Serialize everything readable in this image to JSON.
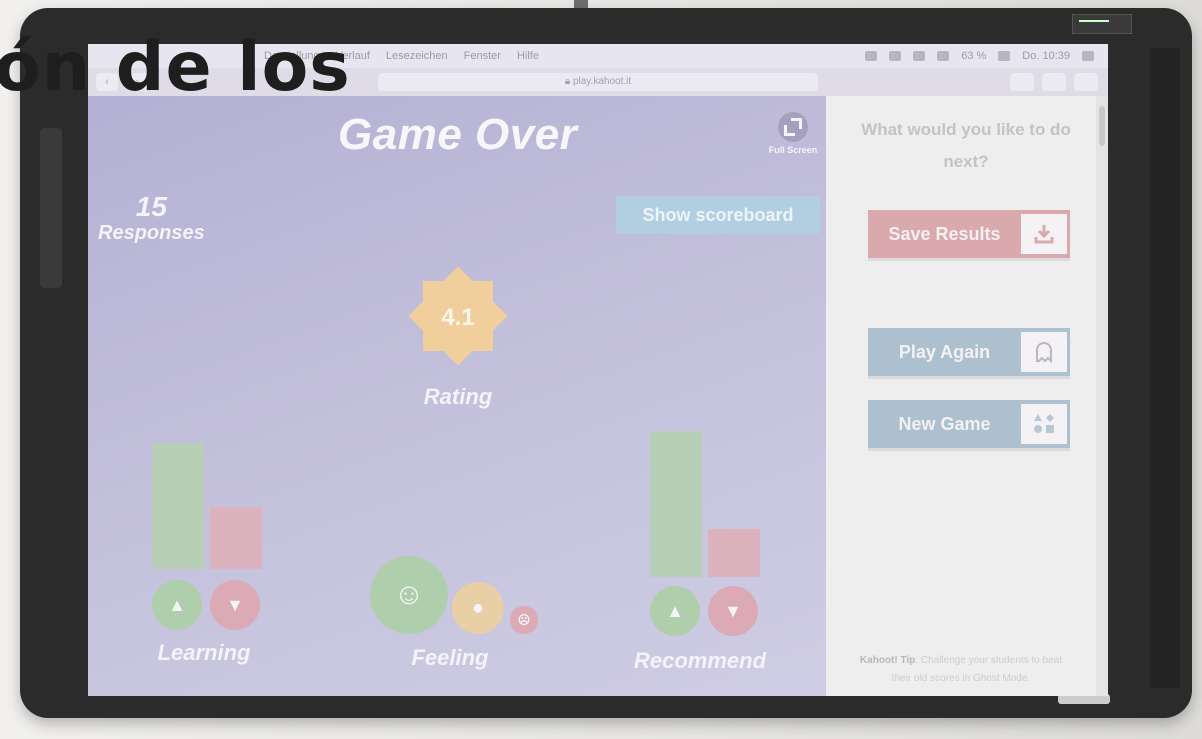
{
  "overlay": {
    "title_fragment": "ón de los"
  },
  "browser": {
    "menu_items": [
      "Darstellung",
      "Verlauf",
      "Lesezeichen",
      "Fenster",
      "Hilfe"
    ],
    "status": {
      "battery": "63 %",
      "clock": "Do. 10:39"
    },
    "url": "play.kahoot.it"
  },
  "game": {
    "title": "Game Over",
    "fullscreen_label": "Full Screen",
    "responses": {
      "count": "15",
      "label": "Responses"
    },
    "scoreboard_button": "Show scoreboard",
    "rating": {
      "value": "4.1",
      "label": "Rating"
    },
    "groups": {
      "learning": {
        "label": "Learning",
        "up_level": 0.66,
        "down_level": 0.4
      },
      "feeling": {
        "label": "Feeling"
      },
      "recommend": {
        "label": "Recommend",
        "up_level": 0.8,
        "down_level": 0.33
      }
    }
  },
  "panel": {
    "title": "What would you like to do next?",
    "save_results": "Save Results",
    "play_again": "Play Again",
    "new_game": "New Game",
    "tip_label": "Kahoot! Tip",
    "tip_text": ": Challenge your students to beat their old scores in Ghost Mode."
  },
  "colors": {
    "screen_bg": "#c8c5dd",
    "save_button": "#d9a9ae",
    "action_button": "#acc0cf",
    "star": "#f1cf9c",
    "positive": "#afcfac",
    "negative": "#dbaab4"
  },
  "icons": {
    "fullscreen": "fullscreen-icon",
    "save": "download-icon",
    "play_again": "ghost-icon",
    "new_game": "shapes-icon",
    "thumb_up": "thumb-up-icon",
    "thumb_down": "thumb-down-icon",
    "happy": "smile-face-icon",
    "neutral": "neutral-face-icon",
    "sad": "sad-face-icon"
  }
}
